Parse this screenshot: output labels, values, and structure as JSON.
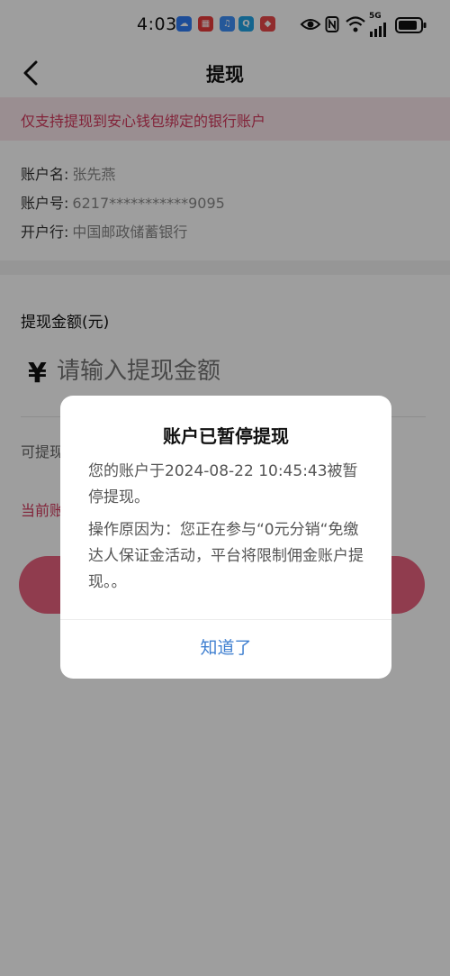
{
  "status_bar": {
    "time": "4:03",
    "network": "5G",
    "apps": [
      {
        "icon": "cloud-app-icon",
        "color": "#2f7cf6",
        "glyph": "☁"
      },
      {
        "icon": "shopping-cart-app-icon",
        "color": "#e83b3b",
        "glyph": "🛒"
      },
      {
        "icon": "music-app-icon",
        "color": "#3d8ef7",
        "glyph": "♫"
      },
      {
        "icon": "search-app-icon",
        "color": "#21a4e6",
        "glyph": "Q"
      },
      {
        "icon": "red-packet-app-icon",
        "color": "#e8484a",
        "glyph": "◆"
      }
    ]
  },
  "nav": {
    "title": "提现"
  },
  "notice": "仅支持提现到安心钱包绑定的银行账户",
  "account": {
    "name_label": "账户名:",
    "name_value": "张先燕",
    "number_label": "账户号:",
    "number_value": "6217***********9095",
    "bank_label": "开户行:",
    "bank_value": "中国邮政储蓄银行"
  },
  "withdraw": {
    "amount_label": "提现金额(元)",
    "currency_symbol": "¥",
    "amount_placeholder": "请输入提现金额",
    "available_partial": "可提现",
    "current_partial": "当前账"
  },
  "dialog": {
    "title": "账户已暂停提现",
    "message_1": "您的账户于2024-08-22 10:45:43被暂停提现。",
    "message_2": "操作原因为：您正在参与“0元分销“免缴达人保证金活动，平台将限制佣金账户提现。。",
    "confirm": "知道了"
  },
  "colors": {
    "accent": "#d2395d",
    "button": "#e8627f",
    "link": "#3f7fd0"
  }
}
